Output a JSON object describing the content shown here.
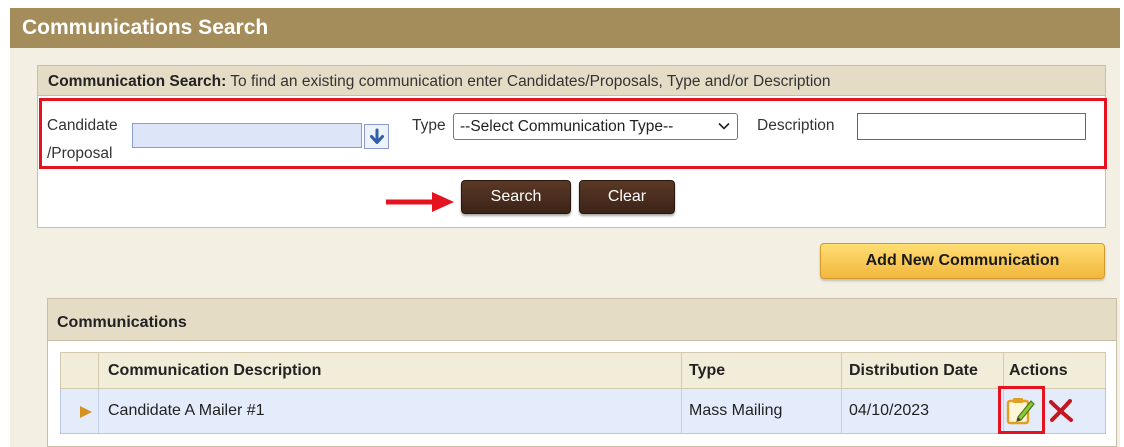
{
  "header": {
    "title": "Communications Search"
  },
  "search_panel": {
    "heading_bold": "Communication Search:",
    "heading_text": " To find an existing communication enter Candidates/Proposals, Type and/or Description",
    "candidate_label_line1": "Candidate",
    "candidate_label_line2": "/Proposal",
    "candidate_value": "",
    "type_label": "Type",
    "type_selected": "--Select Communication Type--",
    "description_label": "Description",
    "description_value": "",
    "search_button": "Search",
    "clear_button": "Clear"
  },
  "add_button": "Add New Communication",
  "communications": {
    "title": "Communications",
    "columns": [
      "Communication Description",
      "Type",
      "Distribution Date",
      "Actions"
    ],
    "rows": [
      {
        "description": "Candidate A Mailer #1",
        "type": "Mass Mailing",
        "date": "04/10/2023"
      }
    ]
  },
  "colors": {
    "header_bg": "#a48c5b",
    "panel_head_bg": "#e5dcc6",
    "highlight_red": "#e5131f",
    "dark_button": "#4a2d1f",
    "gold_button": "#f5c24b",
    "row_bg": "#e4ebfa"
  },
  "icons": {
    "candidate_lookup": "down-arrow-icon",
    "select_chevron": "chevron-down-icon",
    "row_marker": "triangle-right-icon",
    "edit": "edit-pencil-icon",
    "delete": "delete-x-icon",
    "annotation": "red-arrow-icon"
  }
}
